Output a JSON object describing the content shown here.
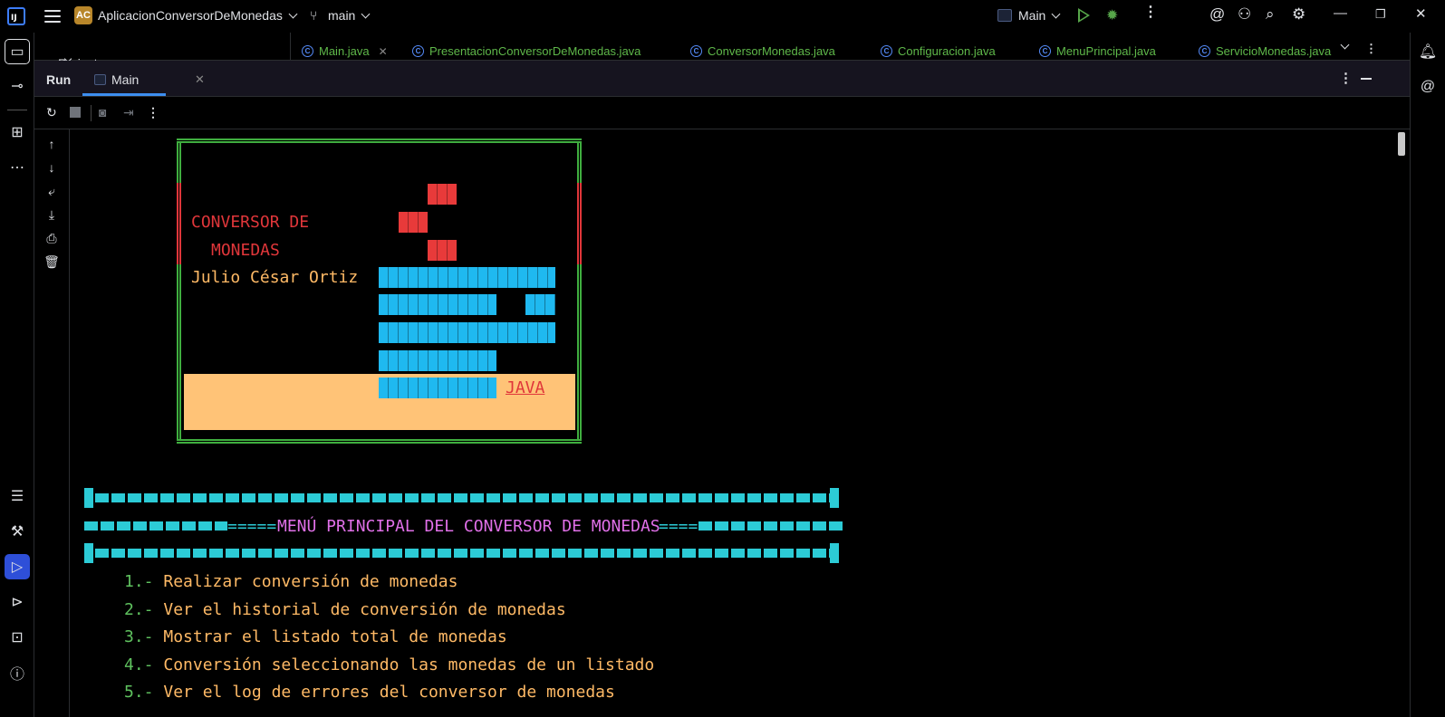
{
  "titlebar": {
    "project_badge": "AC",
    "project_name": "AplicacionConversorDeMonedas",
    "branch": "main",
    "run_config": "Main"
  },
  "project_panel": {
    "label": "Project"
  },
  "editor_tabs": [
    {
      "label": "Main.java",
      "closable": true
    },
    {
      "label": "PresentacionConversorDeMonedas.java"
    },
    {
      "label": "ConversorMonedas.java"
    },
    {
      "label": "Configuracion.java"
    },
    {
      "label": "MenuPrincipal.java"
    },
    {
      "label": "ServicioMonedas.java"
    }
  ],
  "run_panel": {
    "title": "Run",
    "tab_label": "Main"
  },
  "console": {
    "logo_line1": "CONVERSOR DE",
    "logo_line2": "MONEDAS",
    "author": "Julio César Ortiz",
    "java_label": "JAVA",
    "menu_title_left": "=====",
    "menu_title": "MENÚ PRINCIPAL DEL CONVERSOR DE MONEDAS",
    "menu_title_right": "====",
    "menu_items": [
      {
        "num": "1.-",
        "text": "Realizar conversión de monedas"
      },
      {
        "num": "2.-",
        "text": "Ver el historial de conversión de monedas"
      },
      {
        "num": "3.-",
        "text": "Mostrar el listado total de monedas"
      },
      {
        "num": "4.-",
        "text": "Conversión seleccionando las monedas de un listado"
      },
      {
        "num": "5.-",
        "text": "Ver el log de errores del conversor de monedas"
      }
    ]
  },
  "colors": {
    "accent": "#2e4fd8",
    "frame": "#3fae3f",
    "logo_red": "#e0363a",
    "text_orange": "#ffba66",
    "java_blue": "#1fb9f0",
    "menu_cyan": "#2ccbd6",
    "menu_pink": "#e070e8"
  },
  "icons": {
    "left_strip": [
      "folder-icon",
      "commit-icon",
      "structure-icon",
      "more-icon",
      "todo-icon",
      "build-icon",
      "run-icon",
      "services-icon",
      "terminal-icon",
      "problems-icon"
    ],
    "right_strip": [
      "notifications-icon",
      "ai-assistant-icon"
    ]
  }
}
